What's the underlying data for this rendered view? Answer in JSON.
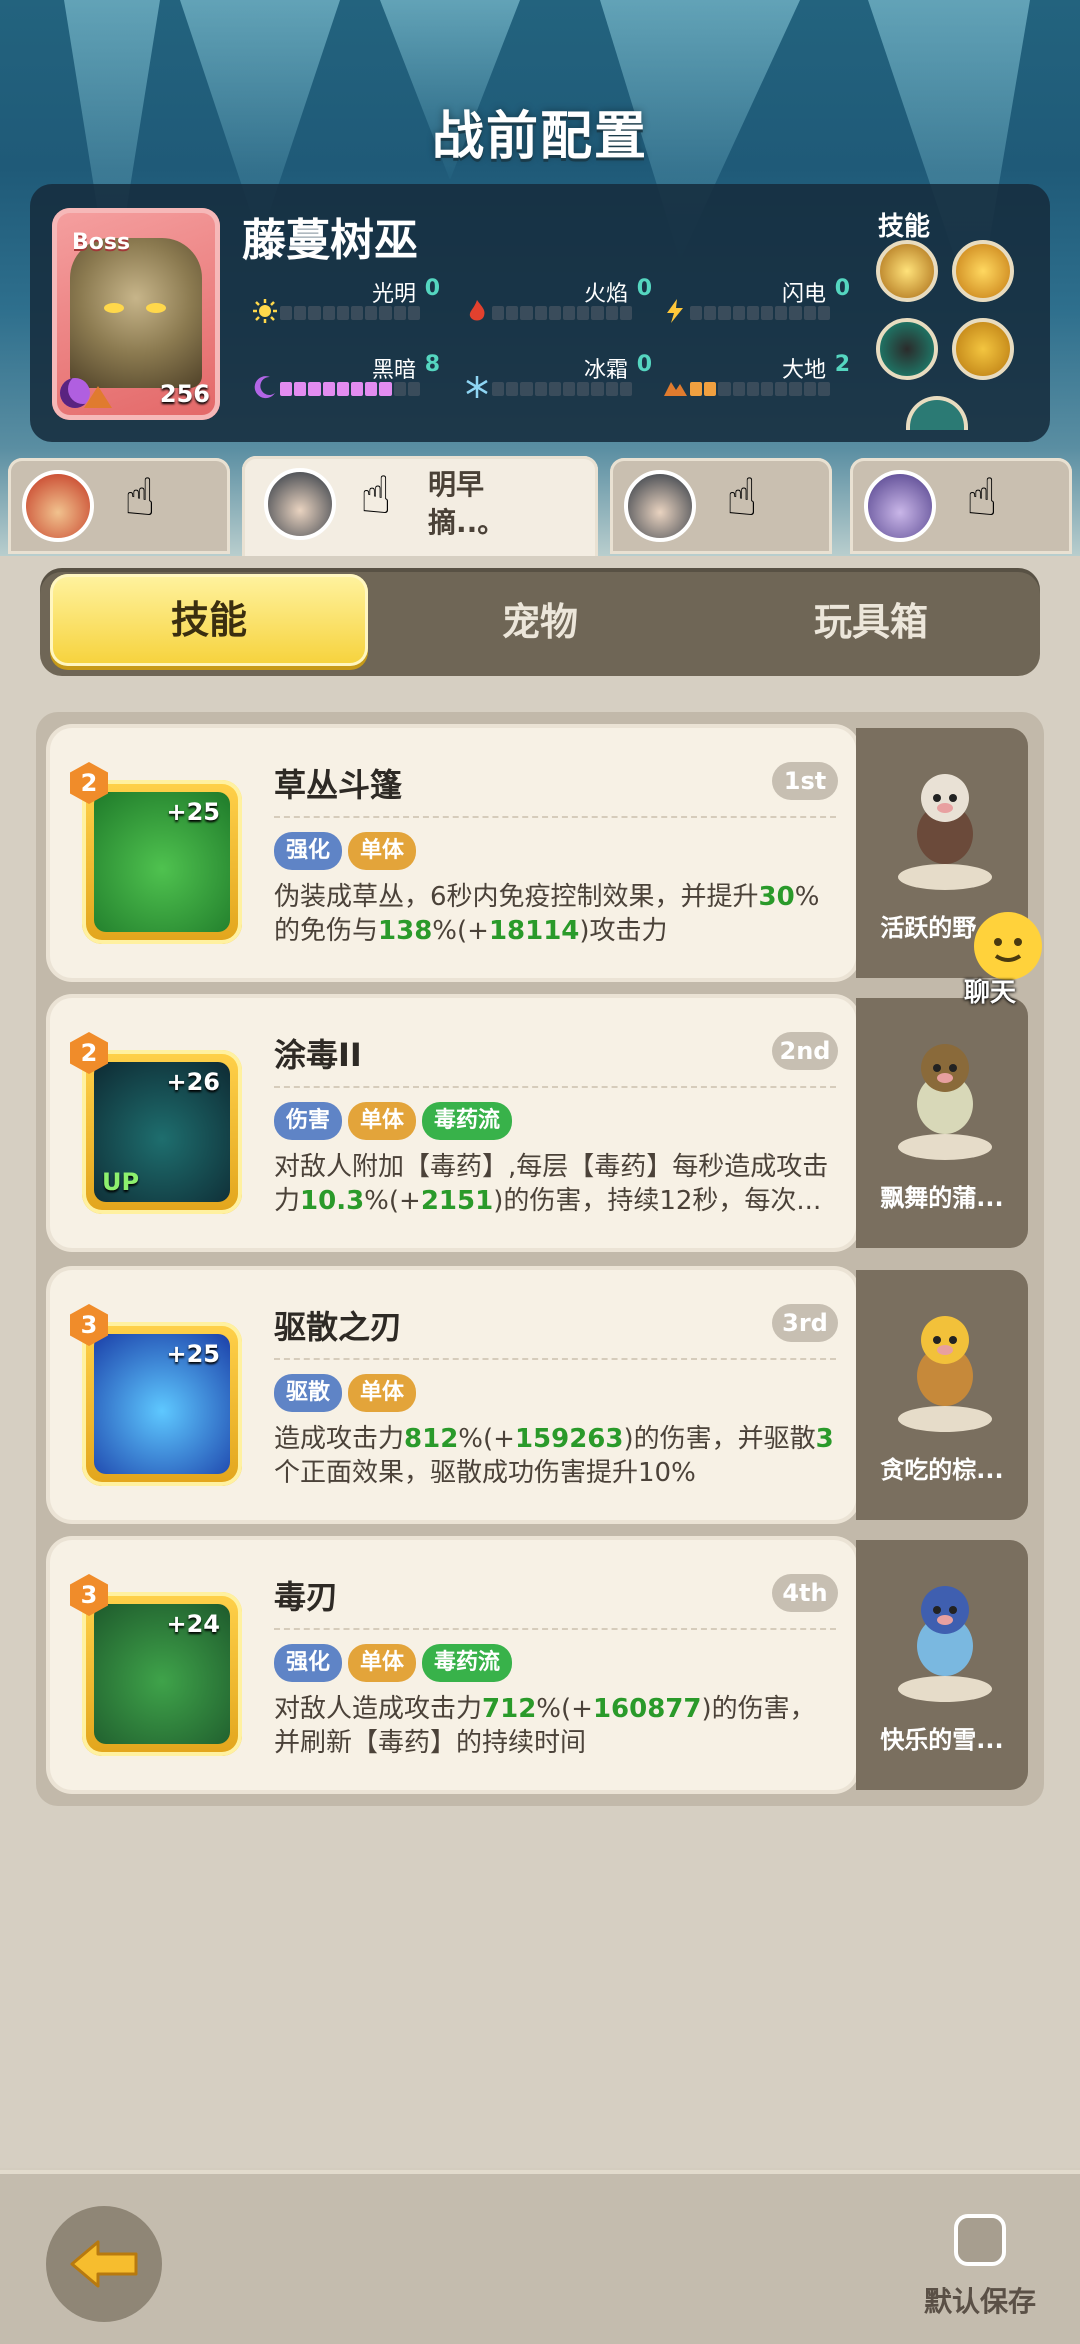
{
  "header": {
    "title": "战前配置"
  },
  "boss": {
    "tag": "Boss",
    "name": "藤蔓树巫",
    "level": "256",
    "skills_label": "技能",
    "stats": [
      {
        "label": "光明",
        "value": "0"
      },
      {
        "label": "火焰",
        "value": "0"
      },
      {
        "label": "闪电",
        "value": "0"
      },
      {
        "label": "黑暗",
        "value": "8"
      },
      {
        "label": "冰霜",
        "value": "0"
      },
      {
        "label": "大地",
        "value": "2"
      }
    ],
    "stat_max": 10
  },
  "characters": [
    {
      "name": "",
      "active": false
    },
    {
      "name": "明早摘..。",
      "active": true
    },
    {
      "name": "",
      "active": false
    },
    {
      "name": "",
      "active": false
    }
  ],
  "tabs": [
    {
      "label": "技能",
      "active": true
    },
    {
      "label": "宠物",
      "active": false
    },
    {
      "label": "玩具箱",
      "active": false
    }
  ],
  "skills": [
    {
      "rank": "2",
      "plus": "+25",
      "up": "",
      "name": "草丛斗篷",
      "order": "1st",
      "tags": [
        {
          "text": "强化",
          "color": "blue"
        },
        {
          "text": "单体",
          "color": "orange"
        }
      ],
      "desc": [
        "伪装成草丛，6秒内免疫控制效果，并提升",
        {
          "g": "30"
        },
        "%的免伤与",
        {
          "g": "138"
        },
        "%(+",
        {
          "g": "18114"
        },
        ")攻击力"
      ],
      "pet": "活跃的野...",
      "icon_colors": [
        "#1f7a2a",
        "#4fc24f"
      ]
    },
    {
      "rank": "2",
      "plus": "+26",
      "up": "UP",
      "name": "涂毒II",
      "order": "2nd",
      "tags": [
        {
          "text": "伤害",
          "color": "blue"
        },
        {
          "text": "单体",
          "color": "orange"
        },
        {
          "text": "毒药流",
          "color": "green"
        }
      ],
      "desc": [
        "对敌人附加【毒药】,每层【毒药】每秒造成攻击力",
        {
          "g": "10.3"
        },
        "%(+",
        {
          "g": "2151"
        },
        ")的伤害，持续12秒，每次..."
      ],
      "pet": "飘舞的蒲...",
      "icon_colors": [
        "#0e2a33",
        "#1e6e6e"
      ]
    },
    {
      "rank": "3",
      "plus": "+25",
      "up": "",
      "name": "驱散之刃",
      "order": "3rd",
      "tags": [
        {
          "text": "驱散",
          "color": "blue"
        },
        {
          "text": "单体",
          "color": "orange"
        }
      ],
      "desc": [
        "造成攻击力",
        {
          "g": "812"
        },
        "%(+",
        {
          "g": "159263"
        },
        ")的伤害，并驱散",
        {
          "g": "3"
        },
        "个正面效果，驱散成功伤害提升10%"
      ],
      "pet": "贪吃的棕...",
      "icon_colors": [
        "#1b3fa8",
        "#5ec8ff"
      ]
    },
    {
      "rank": "3",
      "plus": "+24",
      "up": "",
      "name": "毒刃",
      "order": "4th",
      "tags": [
        {
          "text": "强化",
          "color": "blue"
        },
        {
          "text": "单体",
          "color": "orange"
        },
        {
          "text": "毒药流",
          "color": "green"
        }
      ],
      "desc": [
        "对敌人造成攻击力",
        {
          "g": "712"
        },
        "%(+",
        {
          "g": "160877"
        },
        ")的伤害，并刷新【毒药】的持续时间"
      ],
      "pet": "快乐的雪...",
      "icon_colors": [
        "#1e5a2c",
        "#3fa34a"
      ]
    }
  ],
  "chat": {
    "label": "聊天"
  },
  "footer": {
    "default_save_label": "默认保存",
    "default_save_checked": false
  },
  "icons": {
    "back": "back-arrow-icon",
    "chat": "chat-face-icon",
    "hand": "tap-hand-icon"
  }
}
